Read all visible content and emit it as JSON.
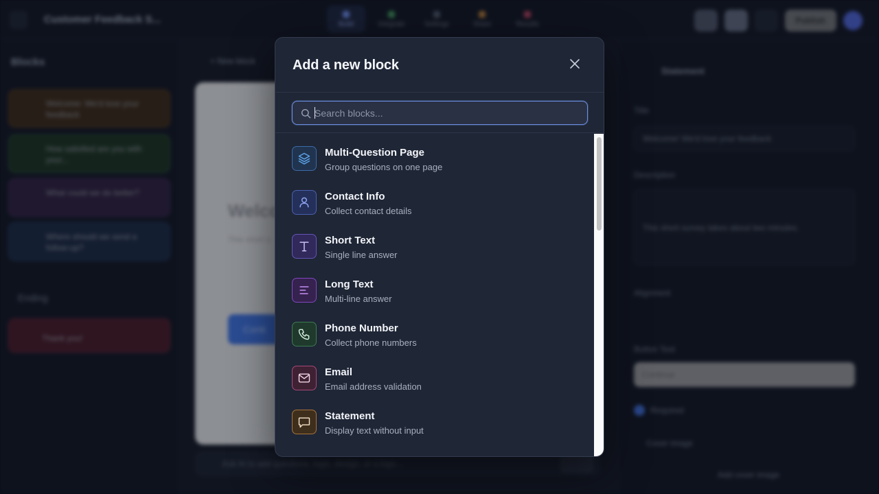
{
  "background": {
    "app_title": "Customer Feedback S...",
    "nav": [
      "Build",
      "Integrate",
      "Settings",
      "Share",
      "Results"
    ],
    "publish_label": "Publish",
    "sidebar_heading": "Blocks",
    "sidebar_blocks": [
      "Welcome: We'd love your feedback",
      "How satisfied are you with your...",
      "What could we do better?",
      "Where should we send a follow-up?"
    ],
    "ending_heading": "Ending",
    "ending_block": "Thank you!",
    "new_block_link": "+ New block",
    "preview_heading": "Welco",
    "preview_sub": "This short s",
    "preview_button": "Conti",
    "bottom_placeholder": "Ask AI to add questions, logic, design, or a logo...",
    "bottom_send": "Send",
    "panel_title": "Statement",
    "panel_labels": {
      "title": "Title",
      "description": "Description",
      "alignment": "Alignment",
      "button_text": "Button Text",
      "required": "Required",
      "cover_image": "Cover image"
    },
    "panel_title_value": "Welcome! We'd love your feedback",
    "panel_description_value": "This short survey takes about two minutes.",
    "panel_button_value": "Continue",
    "panel_add_cover": "Add cover image"
  },
  "modal": {
    "title": "Add a new block",
    "search_placeholder": "Search blocks...",
    "items": [
      {
        "title": "Multi-Question Page",
        "desc": "Group questions on one page",
        "icon": "layers-icon"
      },
      {
        "title": "Contact Info",
        "desc": "Collect contact details",
        "icon": "user-icon"
      },
      {
        "title": "Short Text",
        "desc": "Single line answer",
        "icon": "text-t-icon"
      },
      {
        "title": "Long Text",
        "desc": "Multi-line answer",
        "icon": "align-left-icon"
      },
      {
        "title": "Phone Number",
        "desc": "Collect phone numbers",
        "icon": "phone-icon"
      },
      {
        "title": "Email",
        "desc": "Email address validation",
        "icon": "mail-icon"
      },
      {
        "title": "Statement",
        "desc": "Display text without input",
        "icon": "message-square-icon"
      }
    ]
  },
  "colors": {
    "modal_bg": "#1f2636",
    "accent": "#6b8fe0",
    "icon_blue": "#5aa0e6",
    "icon_indigo": "#8da2f0",
    "icon_violet": "#b3a6f5",
    "icon_purple": "#c58ef2",
    "icon_green": "#7fd3a0",
    "icon_pink": "#f08ab8",
    "icon_amber": "#f0b870"
  }
}
